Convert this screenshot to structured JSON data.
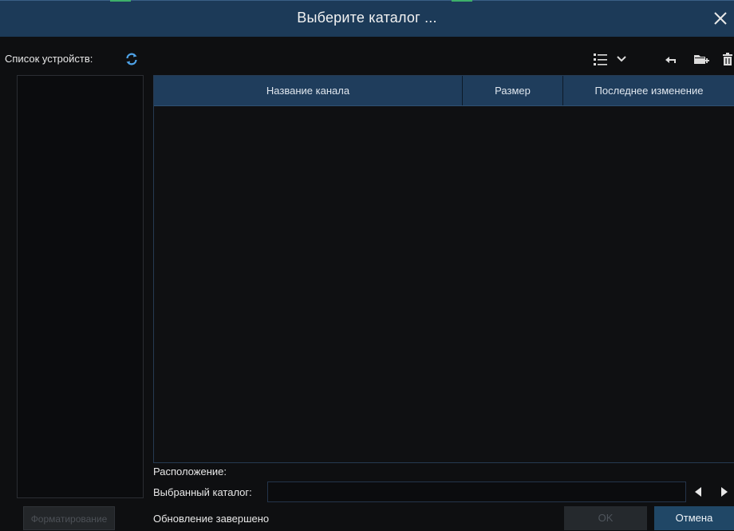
{
  "dialog": {
    "title": "Выберите каталог ..."
  },
  "devices": {
    "label": "Список устройств:"
  },
  "table": {
    "columns": [
      "Название канала",
      "Размер",
      "Последнее изменение"
    ],
    "rows": []
  },
  "location": {
    "label": "Расположение:"
  },
  "selected_dir": {
    "label": "Выбранный каталог:",
    "value": ""
  },
  "footer": {
    "format_label": "Форматирование",
    "status": "Обновление завершено",
    "ok_label": "OK",
    "cancel_label": "Отмена"
  },
  "icons": {
    "close": "close-icon",
    "refresh": "refresh-icon",
    "view_mode": "list-view-icon",
    "dropdown": "chevron-down-icon",
    "back": "back-arrow-icon",
    "new_folder": "new-folder-icon",
    "delete": "trash-icon",
    "prev": "triangle-left-icon",
    "next": "triangle-right-icon"
  },
  "colors": {
    "titlebar": "#1c3a58",
    "table_header": "#1f3d5c",
    "background": "#0e0f11",
    "accent_refresh": "#4fa3e8",
    "cancel_button": "#204766"
  }
}
